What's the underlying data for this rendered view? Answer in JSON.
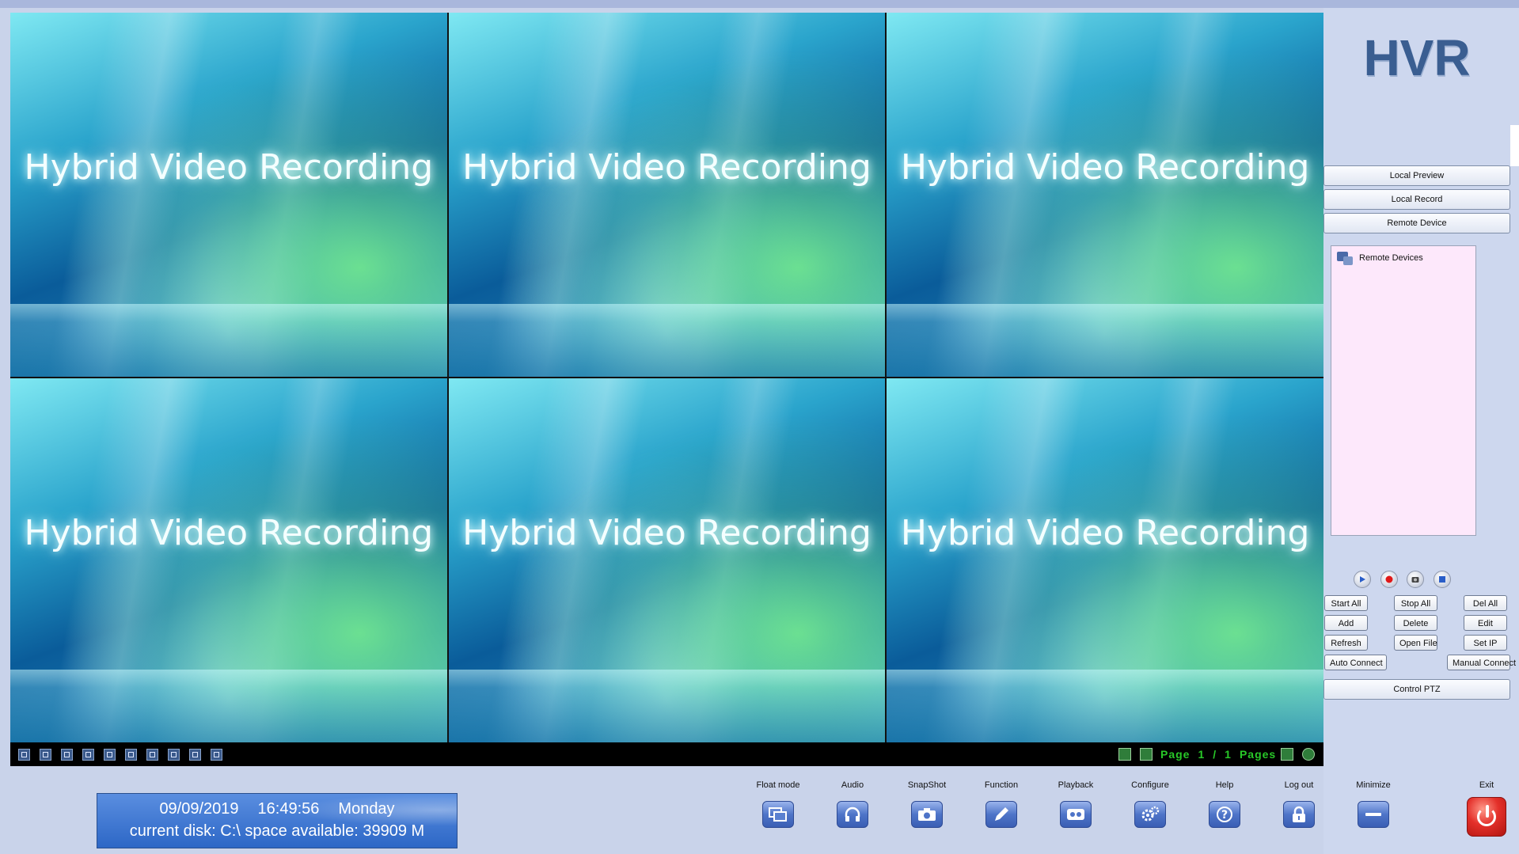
{
  "video": {
    "cells": [
      {
        "title": "Hybrid Video Recording"
      },
      {
        "title": "Hybrid Video Recording"
      },
      {
        "title": "Hybrid Video Recording"
      },
      {
        "title": "Hybrid Video Recording"
      },
      {
        "title": "Hybrid Video Recording"
      },
      {
        "title": "Hybrid Video Recording"
      }
    ],
    "layout_icons": [
      "layout-1-icon",
      "layout-4-icon",
      "layout-6-icon",
      "layout-8-icon",
      "layout-9-icon",
      "layout-10-icon",
      "layout-13-icon",
      "layout-16-icon",
      "layout-25-icon",
      "fullscreen-icon"
    ],
    "pager": {
      "page_label": "Page",
      "current": "1",
      "separator": "/",
      "total": "1",
      "pages_label": "Pages"
    }
  },
  "sidebar": {
    "logo": "HVR",
    "tabs": {
      "local_preview": "Local Preview",
      "local_record": "Local Record",
      "remote_device": "Remote Device"
    },
    "tree_root": "Remote Devices",
    "buttons": {
      "start_all": "Start All",
      "stop_all": "Stop All",
      "del_all": "Del All",
      "add": "Add",
      "delete": "Delete",
      "edit": "Edit",
      "refresh": "Refresh",
      "open_file": "Open File",
      "set_ip": "Set IP",
      "auto_connect": "Auto Connect",
      "manual_connect": "Manual Connect",
      "control_ptz": "Control PTZ"
    }
  },
  "status": {
    "date": "09/09/2019",
    "time": "16:49:56",
    "weekday": "Monday",
    "disk_line": "current disk:  C:\\  space available:  39909 M"
  },
  "toolbar": {
    "float_mode": "Float mode",
    "audio": "Audio",
    "snapshot": "SnapShot",
    "function": "Function",
    "playback": "Playback",
    "configure": "Configure",
    "help": "Help",
    "logout": "Log out",
    "minimize": "Minimize",
    "exit": "Exit"
  },
  "colors": {
    "accent": "#3a5e91",
    "pager": "#28c828",
    "status_bg": "#2d67c6",
    "exit": "#e4302a"
  }
}
